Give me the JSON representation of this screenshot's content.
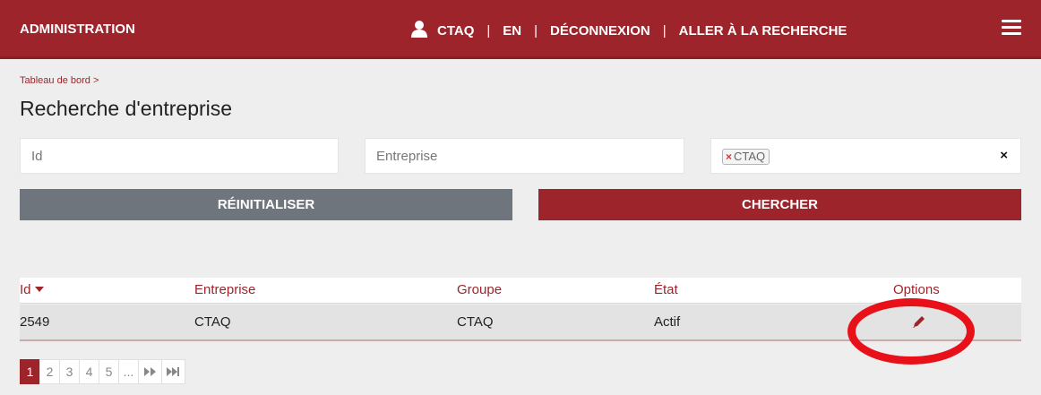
{
  "header": {
    "app_title": "ADMINISTRATION",
    "user": "CTAQ",
    "sep": "|",
    "language": "EN",
    "logout": "DÉCONNEXION",
    "goto_search": "ALLER À LA RECHERCHE"
  },
  "breadcrumb": {
    "items": [
      "Tableau de bord"
    ],
    "separator": ">"
  },
  "page_title": "Recherche d'entreprise",
  "filters": {
    "id_placeholder": "Id",
    "company_placeholder": "Entreprise",
    "group_tag": "CTAQ",
    "tag_remove": "×",
    "clear": "×"
  },
  "buttons": {
    "reset": "RÉINITIALISER",
    "search": "CHERCHER"
  },
  "table": {
    "columns": [
      "Id",
      "Entreprise",
      "Groupe",
      "État",
      "Options"
    ],
    "rows": [
      {
        "id": "2549",
        "company": "CTAQ",
        "group": "CTAQ",
        "state": "Actif"
      }
    ]
  },
  "pagination": {
    "pages": [
      "1",
      "2",
      "3",
      "4",
      "5",
      "..."
    ],
    "next": "▶▶",
    "last": "▶▶|"
  },
  "colors": {
    "brand": "#9d242b",
    "reset_button": "#6e757c",
    "annotation": "#e8111a"
  }
}
